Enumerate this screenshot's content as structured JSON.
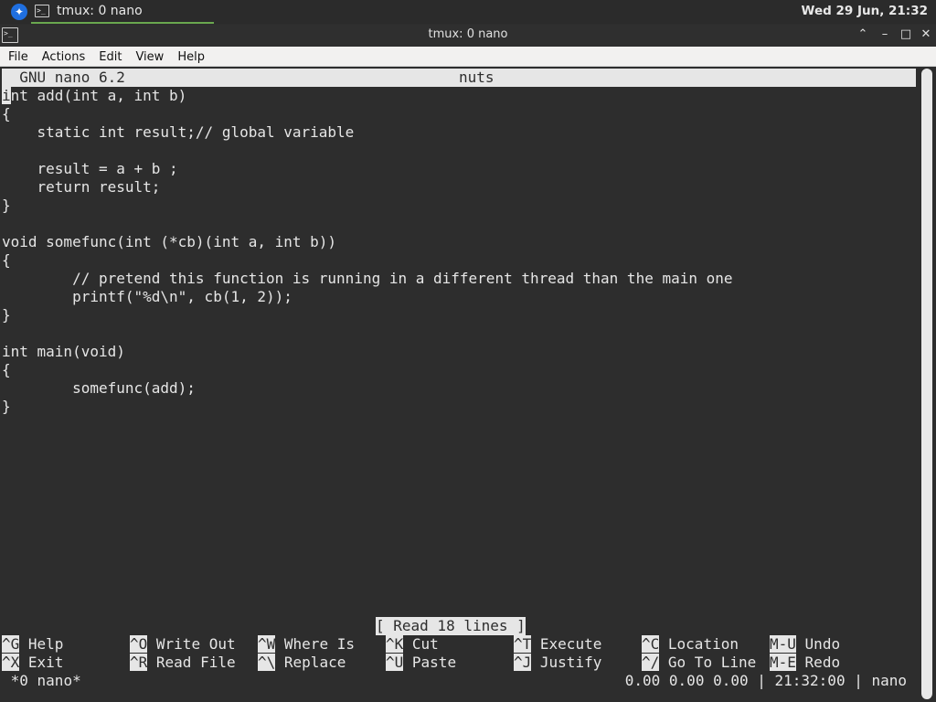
{
  "panel": {
    "task_label": "tmux: 0 nano",
    "clock": "Wed 29 Jun, 21:32",
    "logo_icon": "app-logo-icon",
    "terminal_icon": "terminal-icon"
  },
  "window": {
    "title": "tmux: 0 nano",
    "buttons": [
      "minimize",
      "restore",
      "maximize",
      "close"
    ]
  },
  "menubar": {
    "items": [
      "File",
      "Actions",
      "Edit",
      "View",
      "Help"
    ]
  },
  "nano": {
    "version": "GNU nano 6.2",
    "filename": "nuts",
    "cursor_char": "i",
    "lines": [
      "nt add(int a, int b)",
      "{",
      "    static int result;// global variable",
      "",
      "    result = a + b ;",
      "    return result;",
      "}",
      "",
      "void somefunc(int (*cb)(int a, int b))",
      "{",
      "        // pretend this function is running in a different thread than the main one",
      "        printf(\"%d\\n\", cb(1, 2));",
      "}",
      "",
      "int main(void)",
      "{",
      "        somefunc(add);",
      "}"
    ],
    "status": "[ Read 18 lines ]",
    "shortcuts_row1": [
      {
        "key": "^G",
        "label": "Help"
      },
      {
        "key": "^O",
        "label": "Write Out"
      },
      {
        "key": "^W",
        "label": "Where Is"
      },
      {
        "key": "^K",
        "label": "Cut"
      },
      {
        "key": "^T",
        "label": "Execute"
      },
      {
        "key": "^C",
        "label": "Location"
      },
      {
        "key": "M-U",
        "label": "Undo"
      }
    ],
    "shortcuts_row2": [
      {
        "key": "^X",
        "label": "Exit"
      },
      {
        "key": "^R",
        "label": "Read File"
      },
      {
        "key": "^\\",
        "label": "Replace"
      },
      {
        "key": "^U",
        "label": "Paste"
      },
      {
        "key": "^J",
        "label": "Justify"
      },
      {
        "key": "^/",
        "label": "Go To Line"
      },
      {
        "key": "M-E",
        "label": "Redo"
      }
    ]
  },
  "tmux": {
    "window_label": "*0 nano*",
    "right_status": "0.00 0.00 0.00 | 21:32:00 | nano"
  }
}
